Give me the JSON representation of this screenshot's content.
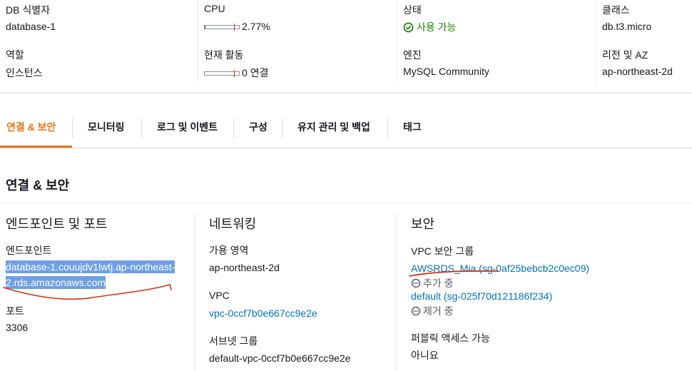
{
  "summary": {
    "db_id_label": "DB 식별자",
    "db_id_value": "database-1",
    "cpu_label": "CPU",
    "cpu_value": "2.77%",
    "cpu_fraction": 0.0277,
    "status_label": "상태",
    "status_value": "사용 가능",
    "class_label": "클래스",
    "class_value": "db.t3.micro",
    "role_label": "역할",
    "role_value": "인스턴스",
    "activity_label": "현재 활동",
    "activity_value": "0 연결",
    "engine_label": "엔진",
    "engine_value": "MySQL Community",
    "region_label": "리전 및 AZ",
    "region_value": "ap-northeast-2d"
  },
  "tabs": [
    {
      "label": "연결 & 보안",
      "active": true
    },
    {
      "label": "모니터링"
    },
    {
      "label": "로그 및 이벤트"
    },
    {
      "label": "구성"
    },
    {
      "label": "유지 관리 및 백업"
    },
    {
      "label": "태그"
    }
  ],
  "panel": {
    "title": "연결 & 보안",
    "endpoint": {
      "title": "엔드포인트 및 포트",
      "endpoint_label": "엔드포인트",
      "endpoint_line1": "database-1.couujdv1lwtj.ap-northeast-",
      "endpoint_line2": "2.rds.amazonaws.com",
      "port_label": "포트",
      "port_value": "3306"
    },
    "network": {
      "title": "네트워킹",
      "az_label": "가용 영역",
      "az_value": "ap-northeast-2d",
      "vpc_label": "VPC",
      "vpc_value": "vpc-0ccf7b0e667cc9e2e",
      "subnet_label": "서브넷 그룹",
      "subnet_value": "default-vpc-0ccf7b0e667cc9e2e"
    },
    "security": {
      "title": "보안",
      "sg_label": "VPC 보안 그룹",
      "sg1_name": "AWSRDS_Mia (sg-0af25bebcb2c0ec09)",
      "sg1_status": "추가 중",
      "sg2_name": "default (sg-025f70d121186f234)",
      "sg2_status": "제거 중",
      "public_label": "퍼블릭 액세스 가능",
      "public_value": "아니요"
    }
  },
  "colors": {
    "accent": "#ec7211",
    "link": "#0073bb",
    "available": "#1d8102",
    "annotation": "#d13212"
  }
}
